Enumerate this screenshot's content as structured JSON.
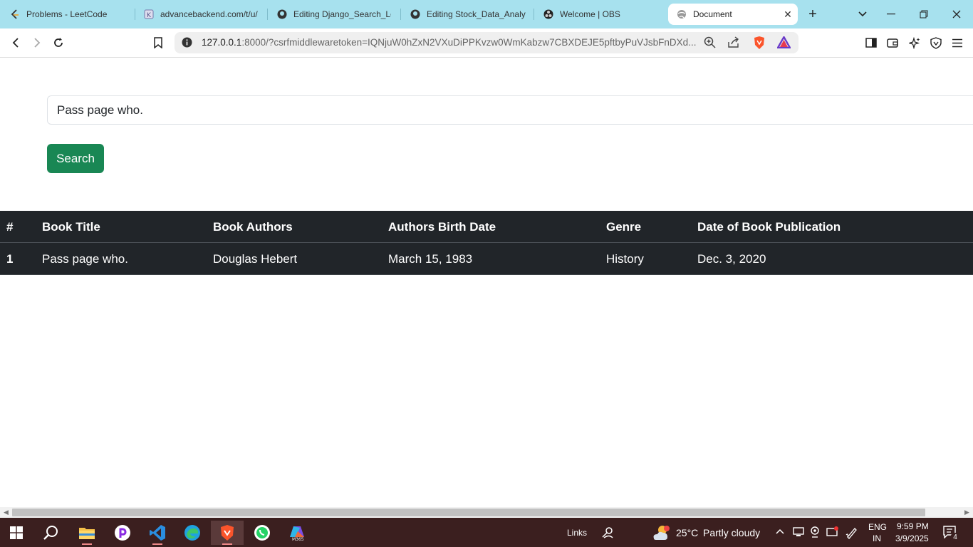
{
  "browser": {
    "tabs": [
      {
        "label": "Problems - LeetCode"
      },
      {
        "label": "advancebackend.com/t/u/"
      },
      {
        "label": "Editing Django_Search_Lo"
      },
      {
        "label": "Editing Stock_Data_Analys"
      },
      {
        "label": "Welcome | OBS"
      },
      {
        "label": "Document"
      }
    ],
    "url_host": "127.0.0.1",
    "url_rest": ":8000/?csrfmiddlewaretoken=IQNjuW0hZxN2VXuDiPPKvzw0WmKabzw7CBXDEJE5pftbyPuVJsbFnDXd..."
  },
  "search": {
    "value": "Pass page who.",
    "button_label": "Search"
  },
  "table": {
    "headers": [
      "#",
      "Book Title",
      "Book Authors",
      "Authors Birth Date",
      "Genre",
      "Date of Book Publication"
    ],
    "rows": [
      [
        "1",
        "Pass page who.",
        "Douglas Hebert",
        "March 15, 1983",
        "History",
        "Dec. 3, 2020"
      ]
    ]
  },
  "taskbar": {
    "links_label": "Links",
    "weather_temp": "25°C",
    "weather_desc": "Partly cloudy",
    "lang_top": "ENG",
    "lang_bottom": "IN",
    "time": "9:59 PM",
    "date": "3/9/2025",
    "notification_count": "4"
  },
  "colors": {
    "tabbar": "#a7e1ee",
    "search_button": "#198754",
    "table_dark": "#212529",
    "taskbar": "#3b1f1f"
  }
}
